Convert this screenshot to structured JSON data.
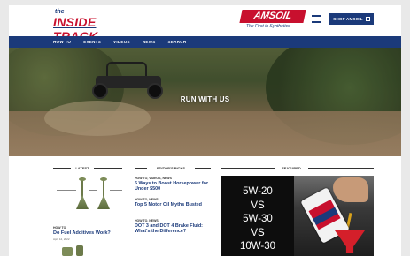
{
  "header": {
    "logo_small": "the",
    "logo_main": "INSIDE TRACK",
    "brand_name": "AMSOIL",
    "brand_tagline": "The First in Synthetics",
    "shop_button": "SHOP AMSOIL"
  },
  "nav": {
    "items": [
      "HOW TO",
      "EVENTS",
      "VIDEOS",
      "NEWS",
      "SEARCH"
    ]
  },
  "hero": {
    "title": "RUN WITH US"
  },
  "sections": {
    "latest": "LATEST",
    "picks": "EDITOR'S PICKS",
    "featured": "FEATURED"
  },
  "latest": {
    "category": "HOW TO",
    "title": "Do Fuel Additives Work?",
    "date": "April 12, 2022"
  },
  "picks": [
    {
      "category": "HOW TO, VIDEOS, NEWS",
      "title": "5 Ways to Boost Horsepower for Under $500"
    },
    {
      "category": "HOW TO, NEWS",
      "title": "Top 5 Motor Oil Myths Busted"
    },
    {
      "category": "HOW TO, NEWS",
      "title": "DOT 3 and DOT 4 Brake Fluid: What's the Difference?"
    }
  ],
  "featured": {
    "lines": [
      "5W-20",
      "VS",
      "5W-30",
      "VS",
      "10W-30"
    ]
  },
  "colors": {
    "brand_red": "#c8102e",
    "brand_navy": "#1b3a7a"
  }
}
